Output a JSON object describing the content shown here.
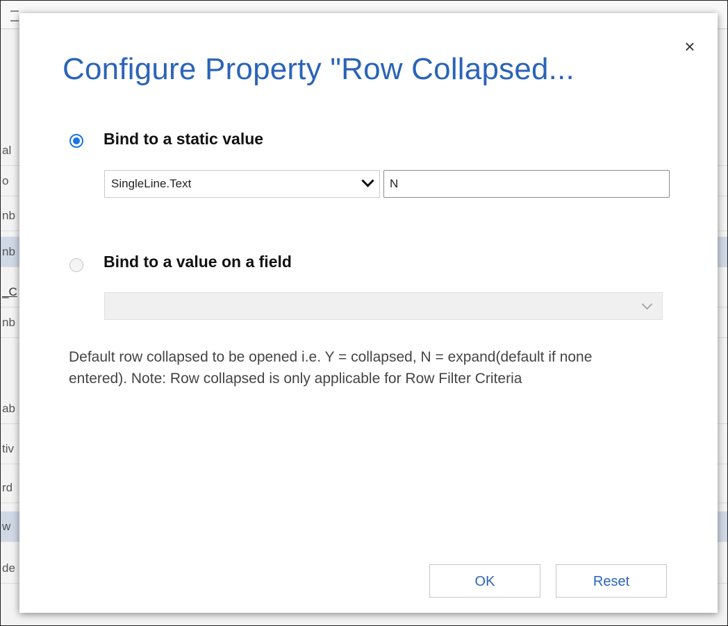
{
  "dialog": {
    "title": "Configure Property \"Row Collapsed...",
    "close_glyph": "×",
    "options": [
      {
        "label": "Bind to a static value",
        "checked": true
      },
      {
        "label": "Bind to a value on a field",
        "checked": false
      }
    ],
    "static": {
      "type_selected": "SingleLine.Text",
      "value": "N"
    },
    "field": {
      "selected": ""
    },
    "description": "Default row collapsed to be opened i.e. Y = collapsed, N = expand(default if none entered). Note: Row collapsed is only applicable for Row Filter Criteria",
    "ok_label": "OK",
    "reset_label": "Reset"
  },
  "background": {
    "row_fragments": [
      "al",
      "o",
      "nb",
      "nb",
      "_C",
      "nb",
      "ab",
      "tiv",
      "rd",
      "w",
      "de"
    ]
  },
  "colors": {
    "title": "#2b64b8",
    "radio_checked": "#1a73e8",
    "button_text": "#2b64b8"
  },
  "icons": {
    "close": "close-icon",
    "dropdown_static": "chevron-down-icon",
    "dropdown_field": "chevron-down-icon"
  }
}
